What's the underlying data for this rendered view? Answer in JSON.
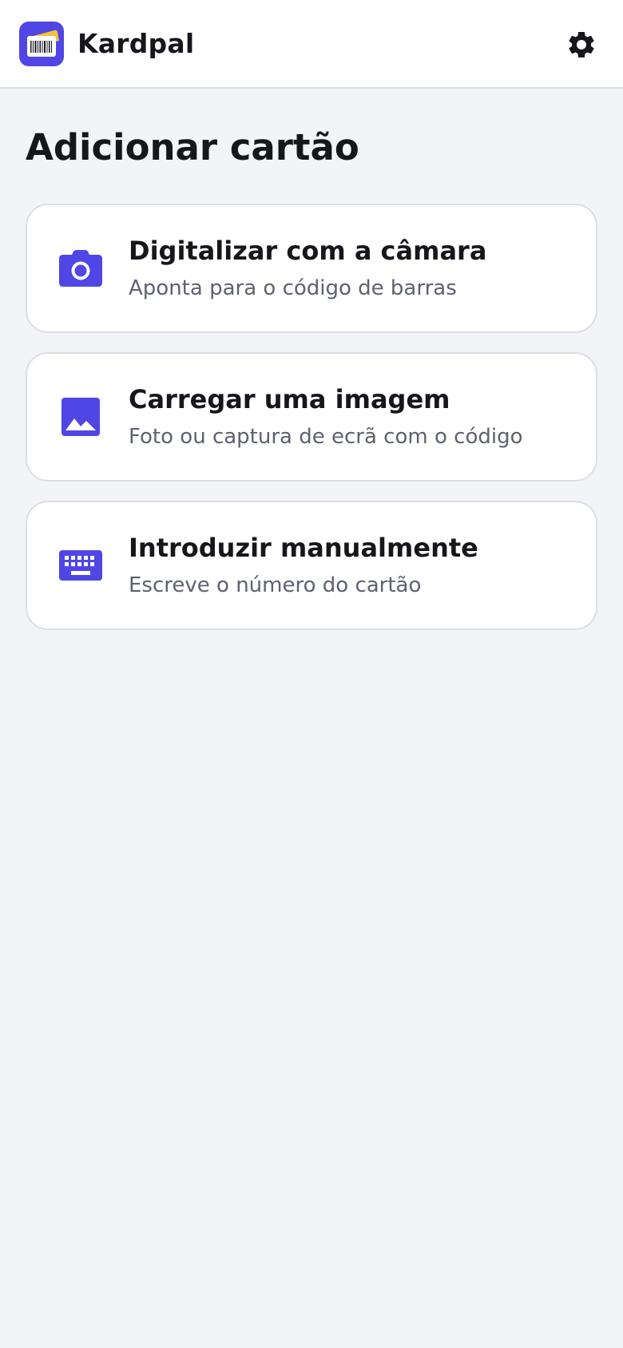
{
  "app": {
    "name": "Kardpal",
    "icon": "barcode-card-logo-icon",
    "settings_icon": "gear-icon"
  },
  "page": {
    "title": "Adicionar cartão"
  },
  "options": [
    {
      "icon": "camera-icon",
      "title": "Digitalizar com a câmara",
      "subtitle": "Aponta para o código de barras"
    },
    {
      "icon": "image-icon",
      "title": "Carregar uma imagem",
      "subtitle": "Foto ou captura de ecrã com o código"
    },
    {
      "icon": "keyboard-icon",
      "title": "Introduzir manualmente",
      "subtitle": "Escreve o número do cartão"
    }
  ],
  "colors": {
    "accent": "#5046e5",
    "background": "#f3f4f8",
    "card": "#ffffff",
    "card_border": "#dcdde6",
    "text_primary": "#16161d",
    "text_secondary": "#5e6170",
    "logo_card_yellow": "#f8c238"
  }
}
